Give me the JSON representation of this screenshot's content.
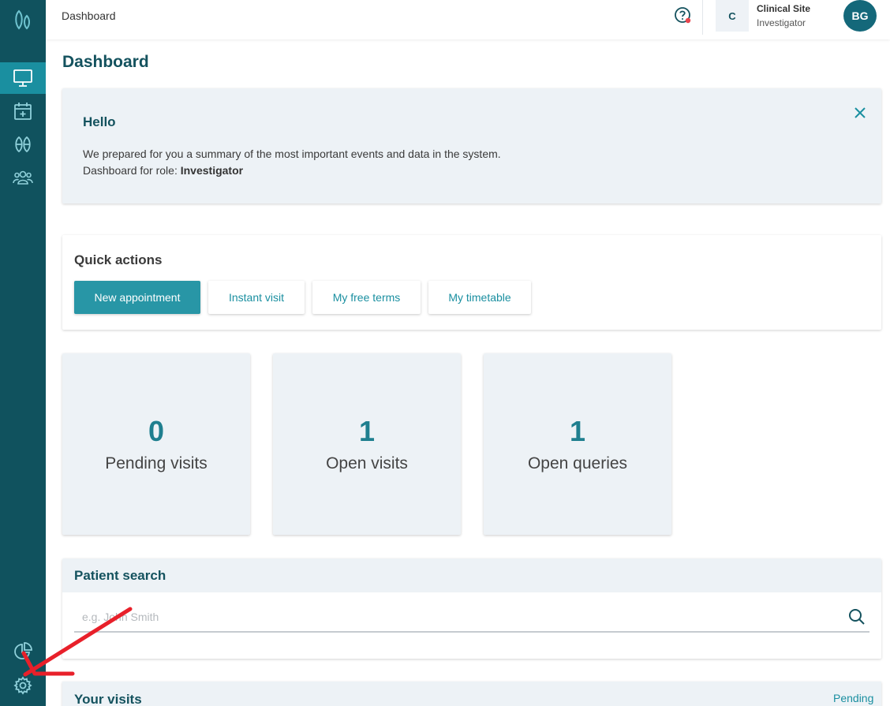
{
  "topbar": {
    "breadcrumb": "Dashboard",
    "site_initial": "C",
    "site_name": "Clinical Site",
    "site_role": "Investigator",
    "avatar_initials": "BG"
  },
  "page": {
    "title": "Dashboard"
  },
  "hello_card": {
    "greeting": "Hello",
    "line1": "We prepared for you a summary of the most important events and data in the system.",
    "line2_prefix": "Dashboard for role:",
    "line2_role": "Investigator"
  },
  "quick_actions": {
    "title": "Quick actions",
    "buttons": [
      "New appointment",
      "Instant visit",
      "My free terms",
      "My timetable"
    ]
  },
  "stats": [
    {
      "value": "0",
      "label": "Pending visits"
    },
    {
      "value": "1",
      "label": "Open visits"
    },
    {
      "value": "1",
      "label": "Open queries"
    }
  ],
  "patient_search": {
    "title": "Patient search",
    "placeholder": "e.g. John Smith"
  },
  "your_visits": {
    "title": "Your visits",
    "filter": "Pending"
  },
  "colors": {
    "sidebar": "#10525e",
    "sidebar_active": "#1a8fa0",
    "primary": "#2896a6",
    "heading": "#14525e",
    "card_bg": "#edf2f6",
    "annotation_arrow": "#e8202a"
  },
  "sidebar_icons": [
    "logo-icon",
    "monitor-icon",
    "calendar-plus-icon",
    "pills-icon",
    "users-icon",
    "pie-chart-icon",
    "gear-icon"
  ]
}
